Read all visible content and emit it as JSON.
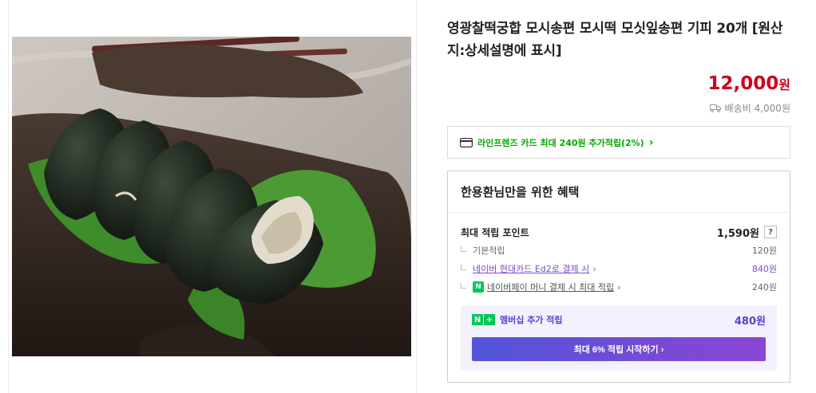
{
  "product": {
    "title": "영광찰떡궁합 모시송편 모시떡 모싯잎송편 기피 20개 [원산지:상세설명에 표시]",
    "price": "12,000",
    "price_unit": "원",
    "shipping": "배송비 4,000원",
    "image_icon": "product-photo"
  },
  "card_benefit": {
    "text": "라인프렌즈 카드 최대 240원 추가적립(2%)",
    "arrow": "›",
    "icon": "credit-card-icon"
  },
  "benefit": {
    "heading": "한용환님만을 위한 혜택",
    "max_points_label": "최대 적립 포인트",
    "max_points_value": "1,590원",
    "help": "?",
    "rows": [
      {
        "label": "기본적립",
        "value": "120원"
      },
      {
        "label": "네이버 현대카드 Ed2로 결제 시",
        "value": "840원",
        "arrow": "›"
      },
      {
        "label": "네이버페이 머니 결제 시 최대 적립",
        "value": "240원",
        "arrow": "›",
        "badge": "N"
      }
    ],
    "membership": {
      "badge_n": "N",
      "badge_plus": "+",
      "label": "멤버십 추가 적립",
      "value": "480원",
      "cta": "최대 6% 적립 시작하기 ›"
    }
  },
  "colors": {
    "price": "#d0021b",
    "green": "#08a600",
    "purple": "#7b4ad6",
    "cta_from": "#5254d9",
    "cta_to": "#8b45d4"
  }
}
